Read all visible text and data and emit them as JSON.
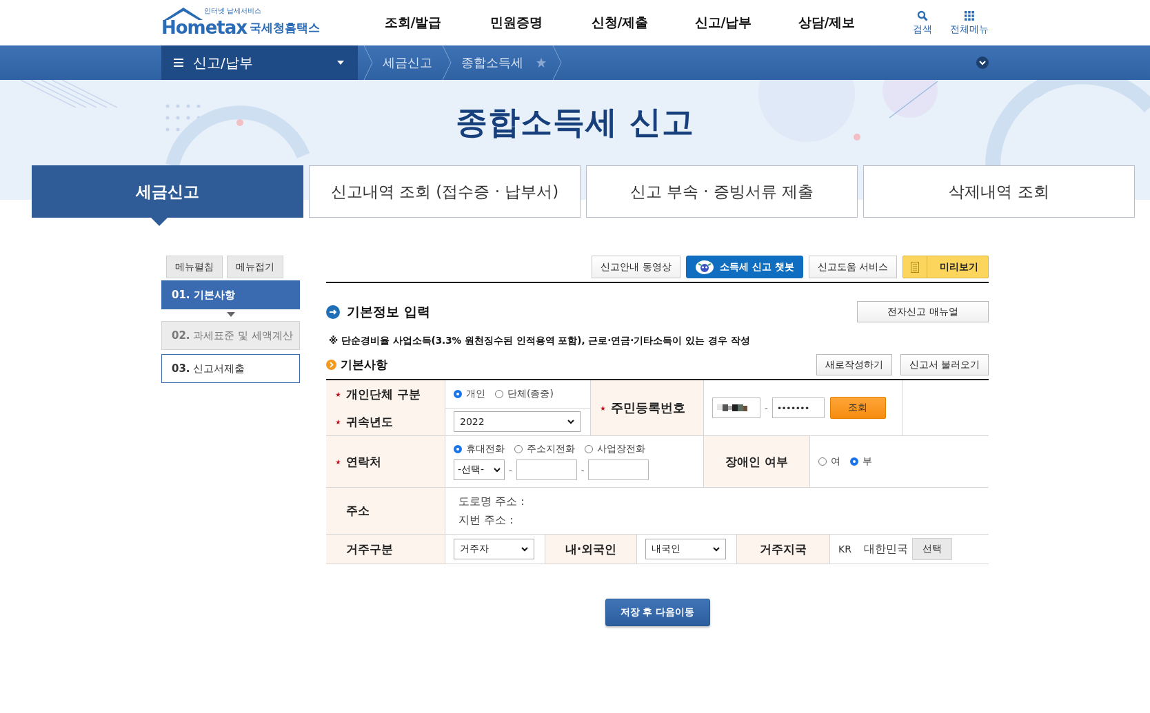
{
  "header": {
    "logo_tagline": "인터넷 납세서비스",
    "logo": "Hometax",
    "logo_sub": "국세청홈택스",
    "menu": [
      "조회/발급",
      "민원증명",
      "신청/제출",
      "신고/납부",
      "상담/제보"
    ],
    "tools": [
      {
        "label": "검색",
        "kind": "search"
      },
      {
        "label": "전체메뉴",
        "kind": "grid"
      }
    ]
  },
  "breadcrumb": {
    "menu": "신고/납부",
    "items": [
      "세금신고",
      "종합소득세"
    ]
  },
  "page_title": "종합소득세 신고",
  "tabs": [
    {
      "label": "세금신고",
      "selected": true
    },
    {
      "label": "신고내역 조회 (접수증 · 납부서)",
      "selected": false
    },
    {
      "label": "신고 부속 · 증빙서류 제출",
      "selected": false
    },
    {
      "label": "삭제내역 조회",
      "selected": false
    }
  ],
  "sidebar": {
    "buttons": [
      "메뉴펼침",
      "메뉴접기"
    ],
    "steps": [
      {
        "number": "01.",
        "label": "기본사항",
        "selected": true,
        "disabled": false
      },
      {
        "number": "02.",
        "label": "과세표준 및 세액계산",
        "selected": false,
        "disabled": true
      },
      {
        "number": "03.",
        "label": "신고서제출",
        "selected": false,
        "disabled": false
      }
    ]
  },
  "toolbar": [
    {
      "label": "신고안내 동영상",
      "kind": "plain"
    },
    {
      "label": "소득세 신고 챗봇",
      "kind": "chatbot"
    },
    {
      "label": "신고도움 서비스",
      "kind": "plain"
    },
    {
      "label": "미리보기",
      "kind": "preview"
    }
  ],
  "section": {
    "title": "기본정보 입력",
    "manual_button": "전자신고 매뉴얼",
    "notice": "※ 단순경비율 사업소득(3.3% 원천징수된 인적용역 포함), 근로·연금·기타소득이 있는 경우 작성",
    "subtitle": "기본사항",
    "actions": [
      "새로작성하기",
      "신고서 불러오기"
    ]
  },
  "form": {
    "person_type": {
      "label": "개인단체 구분",
      "required": true,
      "options": [
        {
          "label": "개인",
          "selected": true
        },
        {
          "label": "단체(종중)",
          "selected": false
        }
      ]
    },
    "year": {
      "label": "귀속년도",
      "required": true,
      "value": "2022"
    },
    "resident_number": {
      "label": "주민등록번호",
      "required": true,
      "parts": [
        {
          "kind": "masked"
        },
        {
          "kind": "separator",
          "text": "-"
        },
        {
          "kind": "input",
          "value": "•••••••"
        }
      ],
      "lookup_button": "조회"
    },
    "contact": {
      "label": "연락처",
      "required": true,
      "options": [
        {
          "label": "휴대전화",
          "selected": true
        },
        {
          "label": "주소지전화",
          "selected": false
        },
        {
          "label": "사업장전화",
          "selected": false
        }
      ],
      "parts": [
        {
          "kind": "select",
          "value": "-선택-"
        },
        {
          "kind": "separator",
          "text": "-"
        },
        {
          "kind": "input"
        },
        {
          "kind": "separator",
          "text": "-"
        },
        {
          "kind": "input"
        }
      ]
    },
    "disability": {
      "label": "장애인 여부",
      "options": [
        {
          "label": "여",
          "selected": false
        },
        {
          "label": "부",
          "selected": true
        }
      ]
    },
    "address": {
      "label": "주소",
      "lines": [
        "도로명 주소 :",
        "지번 주소 :"
      ]
    },
    "residence": {
      "label": "거주구분",
      "value": "거주자"
    },
    "nationality": {
      "label": "내·외국인",
      "value": "내국인"
    },
    "country": {
      "label": "거주지국",
      "code": "KR",
      "name": "대한민국",
      "button": "선택"
    }
  },
  "save_button": "저장 후 다음이동"
}
